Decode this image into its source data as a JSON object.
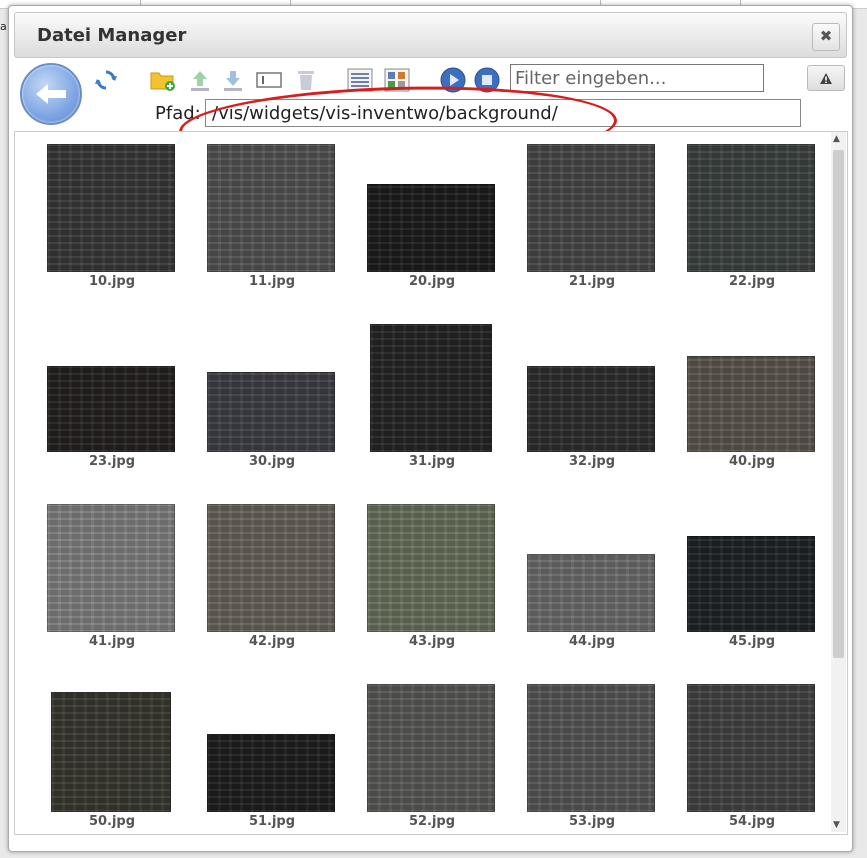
{
  "page": {
    "left_label": "a:"
  },
  "dialog": {
    "title": "Datei Manager",
    "close_label": "✖",
    "filter": {
      "placeholder": "Filter eingeben...",
      "value": ""
    },
    "path": {
      "label": "Pfad:",
      "value": "/vis/widgets/vis-inventwo/background/"
    },
    "toolbar_icons": [
      "refresh-icon",
      "new-folder-icon",
      "upload-icon",
      "download-icon",
      "rename-icon",
      "delete-icon",
      "list-view-icon",
      "table-view-icon",
      "play-icon",
      "stop-icon"
    ],
    "warning_icon": "warning-icon"
  },
  "files": [
    {
      "name": "10.jpg",
      "color": "#3a3a3a"
    },
    {
      "name": "11.jpg",
      "color": "#555555"
    },
    {
      "name": "20.jpg",
      "color": "#1d1d1d"
    },
    {
      "name": "21.jpg",
      "color": "#4a4a4a"
    },
    {
      "name": "22.jpg",
      "color": "#3d4441"
    },
    {
      "name": "23.jpg",
      "color": "#262222"
    },
    {
      "name": "30.jpg",
      "color": "#404048"
    },
    {
      "name": "31.jpg",
      "color": "#262626"
    },
    {
      "name": "32.jpg",
      "color": "#2f2f2f"
    },
    {
      "name": "40.jpg",
      "color": "#5d5750"
    },
    {
      "name": "41.jpg",
      "color": "#828282"
    },
    {
      "name": "42.jpg",
      "color": "#6a645d"
    },
    {
      "name": "43.jpg",
      "color": "#6b735e"
    },
    {
      "name": "44.jpg",
      "color": "#6e6e6e"
    },
    {
      "name": "45.jpg",
      "color": "#202428"
    },
    {
      "name": "50.jpg",
      "color": "#3a3a32"
    },
    {
      "name": "51.jpg",
      "color": "#1f1f1f"
    },
    {
      "name": "52.jpg",
      "color": "#5a5a58"
    },
    {
      "name": "53.jpg",
      "color": "#585858"
    },
    {
      "name": "54.jpg",
      "color": "#444444"
    }
  ]
}
